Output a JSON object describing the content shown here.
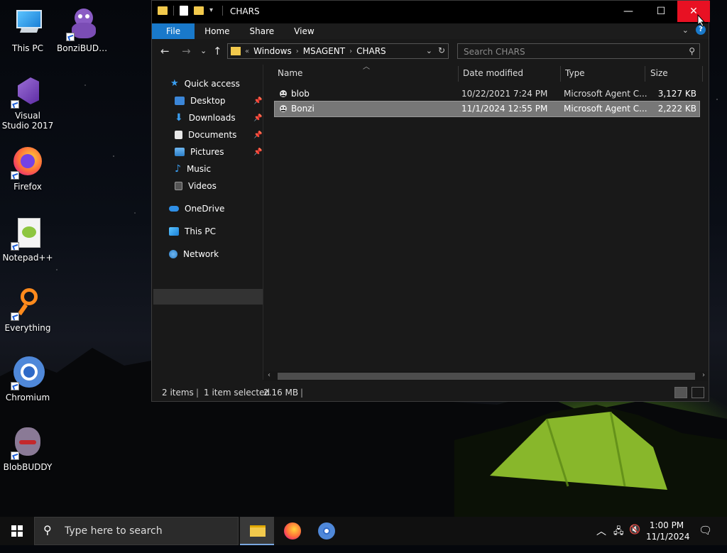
{
  "desktop": {
    "icons": [
      {
        "label": "This PC"
      },
      {
        "label": "BonziBUDD..."
      },
      {
        "label": "Visual Studio 2017"
      },
      {
        "label": "Firefox"
      },
      {
        "label": "Notepad++"
      },
      {
        "label": "Everything"
      },
      {
        "label": "Chromium"
      },
      {
        "label": "BlobBUDDY"
      }
    ]
  },
  "window": {
    "title": "CHARS",
    "ribbon_tabs": [
      "File",
      "Home",
      "Share",
      "View"
    ],
    "address": {
      "overflow": "«",
      "crumbs": [
        "Windows",
        "MSAGENT",
        "CHARS"
      ]
    },
    "search": {
      "placeholder": "Search CHARS"
    },
    "nav": [
      {
        "label": "Quick access"
      },
      {
        "label": "Desktop"
      },
      {
        "label": "Downloads"
      },
      {
        "label": "Documents"
      },
      {
        "label": "Pictures"
      },
      {
        "label": "Music"
      },
      {
        "label": "Videos"
      },
      {
        "label": "OneDrive"
      },
      {
        "label": "This PC"
      },
      {
        "label": "Network"
      }
    ],
    "columns": {
      "name": "Name",
      "date": "Date modified",
      "type": "Type",
      "size": "Size"
    },
    "files": [
      {
        "name": "blob",
        "date": "10/22/2021 7:24 PM",
        "type": "Microsoft Agent C...",
        "size": "3,127 KB"
      },
      {
        "name": "Bonzi",
        "date": "11/1/2024 12:55 PM",
        "type": "Microsoft Agent C...",
        "size": "2,222 KB"
      }
    ],
    "status": {
      "items": "2 items",
      "selected": "1 item selected",
      "size": "2.16 MB"
    }
  },
  "taskbar": {
    "search_placeholder": "Type here to search",
    "time": "1:00 PM",
    "date": "11/1/2024"
  },
  "colors": {
    "accent": "#1979ca",
    "close": "#e81123",
    "folder": "#f2c94c"
  }
}
